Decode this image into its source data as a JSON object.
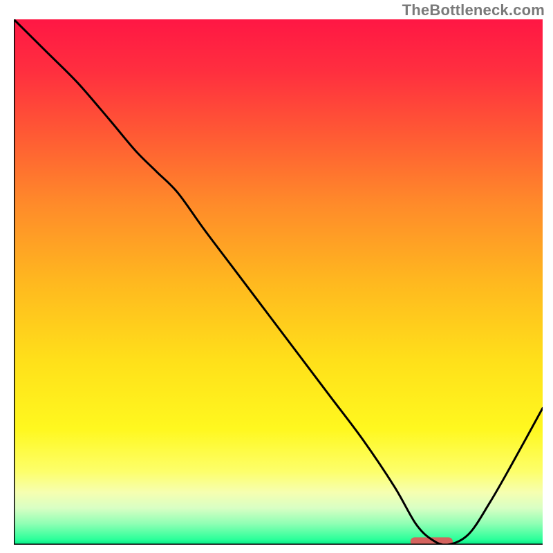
{
  "watermark": "TheBottleneck.com",
  "chart_data": {
    "type": "line",
    "title": "",
    "xlabel": "",
    "ylabel": "",
    "xlim": [
      0,
      100
    ],
    "ylim": [
      0,
      100
    ],
    "grid": false,
    "legend": false,
    "annotations": [],
    "background_gradient_stops": [
      {
        "pct": 0,
        "color": "#ff1744"
      },
      {
        "pct": 10,
        "color": "#ff2f3f"
      },
      {
        "pct": 22,
        "color": "#ff5a34"
      },
      {
        "pct": 35,
        "color": "#ff8a2a"
      },
      {
        "pct": 50,
        "color": "#ffb81f"
      },
      {
        "pct": 65,
        "color": "#ffe01a"
      },
      {
        "pct": 78,
        "color": "#fff81f"
      },
      {
        "pct": 86,
        "color": "#fdff6a"
      },
      {
        "pct": 90,
        "color": "#f6ffb0"
      },
      {
        "pct": 93,
        "color": "#d9ffc4"
      },
      {
        "pct": 96,
        "color": "#8fffb4"
      },
      {
        "pct": 99,
        "color": "#2bff9a"
      },
      {
        "pct": 100,
        "color": "#00e884"
      }
    ],
    "series": [
      {
        "name": "bottleneck-curve",
        "color": "#000000",
        "x": [
          0,
          6,
          12,
          18,
          23,
          27,
          31,
          36,
          42,
          48,
          54,
          60,
          66,
          72,
          76,
          79,
          82,
          86,
          90,
          94,
          100
        ],
        "y": [
          100,
          94,
          88,
          81,
          75,
          71,
          67,
          60,
          52,
          44,
          36,
          28,
          20,
          11,
          4,
          1,
          0,
          2,
          8,
          15,
          26
        ]
      }
    ],
    "marker": {
      "name": "optimal-region",
      "color": "#d4635e",
      "x_center": 79,
      "width": 8,
      "y": 0.6,
      "height": 1.6
    },
    "axes": {
      "show_border_left": true,
      "show_border_bottom": true,
      "show_border_top": false,
      "show_border_right": false,
      "border_color": "#000000",
      "border_width": 3
    }
  }
}
